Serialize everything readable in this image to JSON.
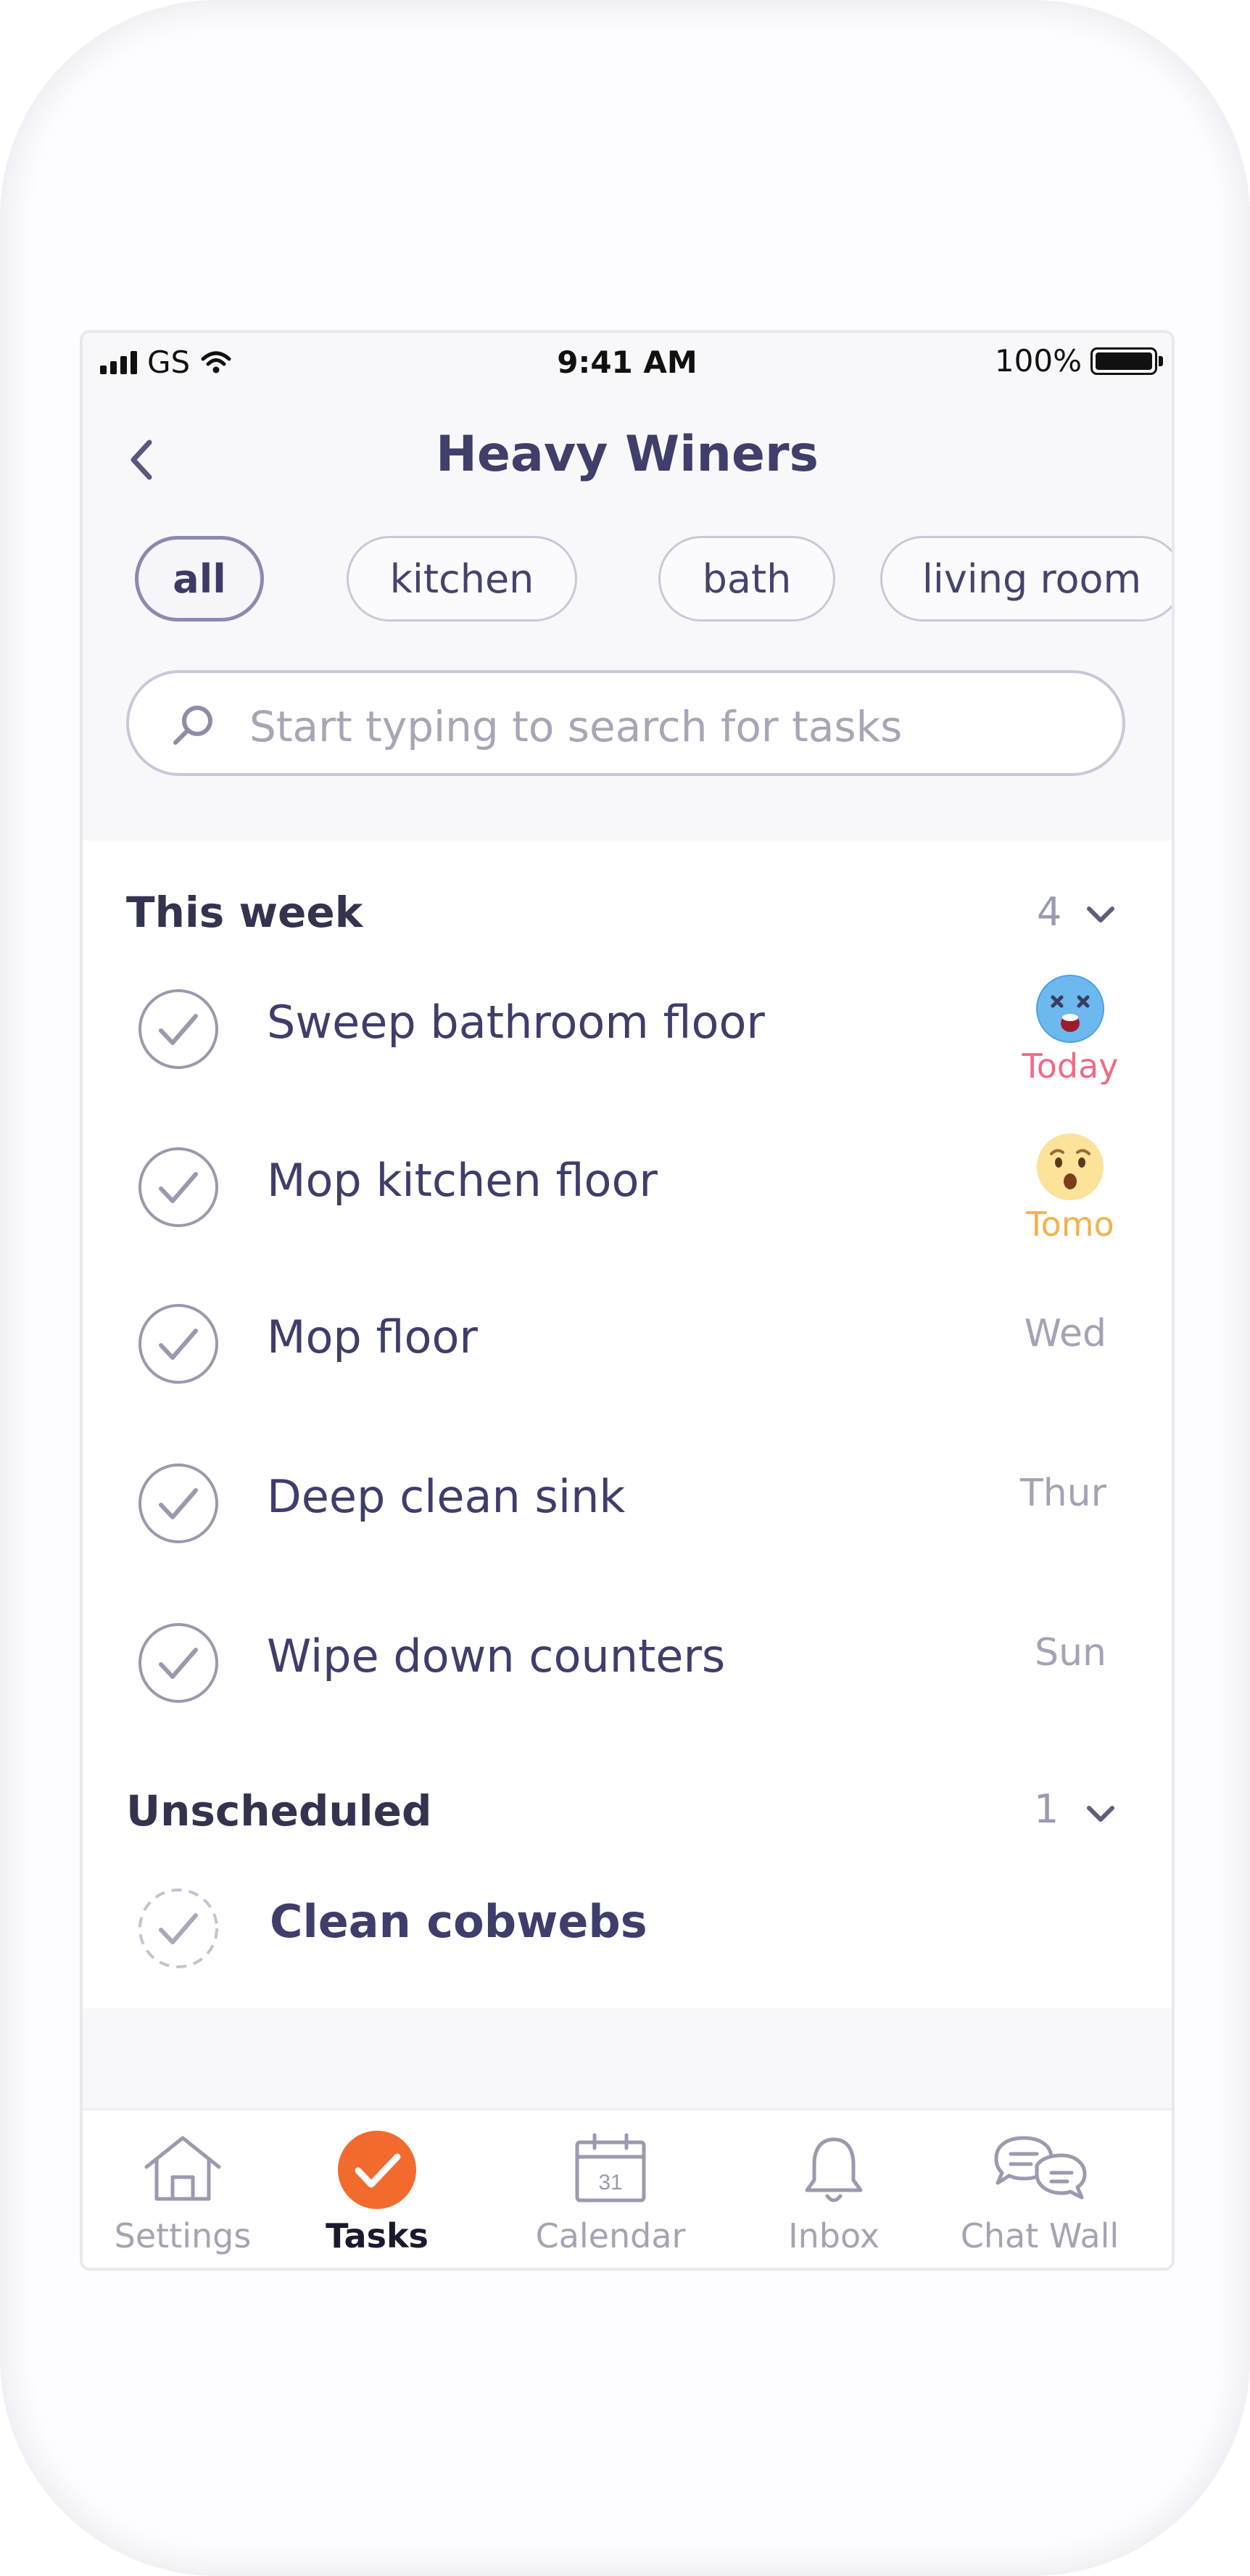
{
  "status_bar": {
    "carrier": "GS",
    "time": "9:41 AM",
    "battery": "100%"
  },
  "header": {
    "title": "Heavy Winers"
  },
  "filters": [
    {
      "label": "all",
      "active": true
    },
    {
      "label": "kitchen",
      "active": false
    },
    {
      "label": "bath",
      "active": false
    },
    {
      "label": "living room",
      "active": false
    }
  ],
  "search": {
    "placeholder": "Start typing to search for tasks"
  },
  "sections": [
    {
      "title": "This week",
      "count": "4",
      "tasks": [
        {
          "title": "Sweep bathroom floor",
          "due": "Today",
          "due_color": "#f06b84",
          "emoji": "dizzy-face-icon"
        },
        {
          "title": "Mop kitchen floor",
          "due": "Tomo",
          "due_color": "#f7b14a",
          "emoji": "surprised-face-icon"
        },
        {
          "title": "Mop floor",
          "due": "Wed"
        },
        {
          "title": "Deep clean sink",
          "due": "Thur"
        },
        {
          "title": "Wipe down counters",
          "due": "Sun"
        }
      ]
    },
    {
      "title": "Unscheduled",
      "count": "1",
      "tasks": [
        {
          "title": "Clean cobwebs",
          "due": ""
        }
      ]
    }
  ],
  "tab_bar": {
    "items": [
      {
        "label": "Settings",
        "icon": "home-icon",
        "active": false
      },
      {
        "label": "Tasks",
        "icon": "checkmark-icon",
        "active": true
      },
      {
        "label": "Calendar",
        "icon": "calendar-icon",
        "calendar_day": "31",
        "active": false
      },
      {
        "label": "Inbox",
        "icon": "bell-icon",
        "active": false
      },
      {
        "label": "Chat Wall",
        "icon": "chat-bubbles-icon",
        "active": false
      }
    ]
  },
  "colors": {
    "accent": "#f26a2e",
    "text_primary": "#3f3d6b",
    "text_muted": "#a3a3b5",
    "today": "#f06b84",
    "tomorrow": "#f7b14a"
  }
}
